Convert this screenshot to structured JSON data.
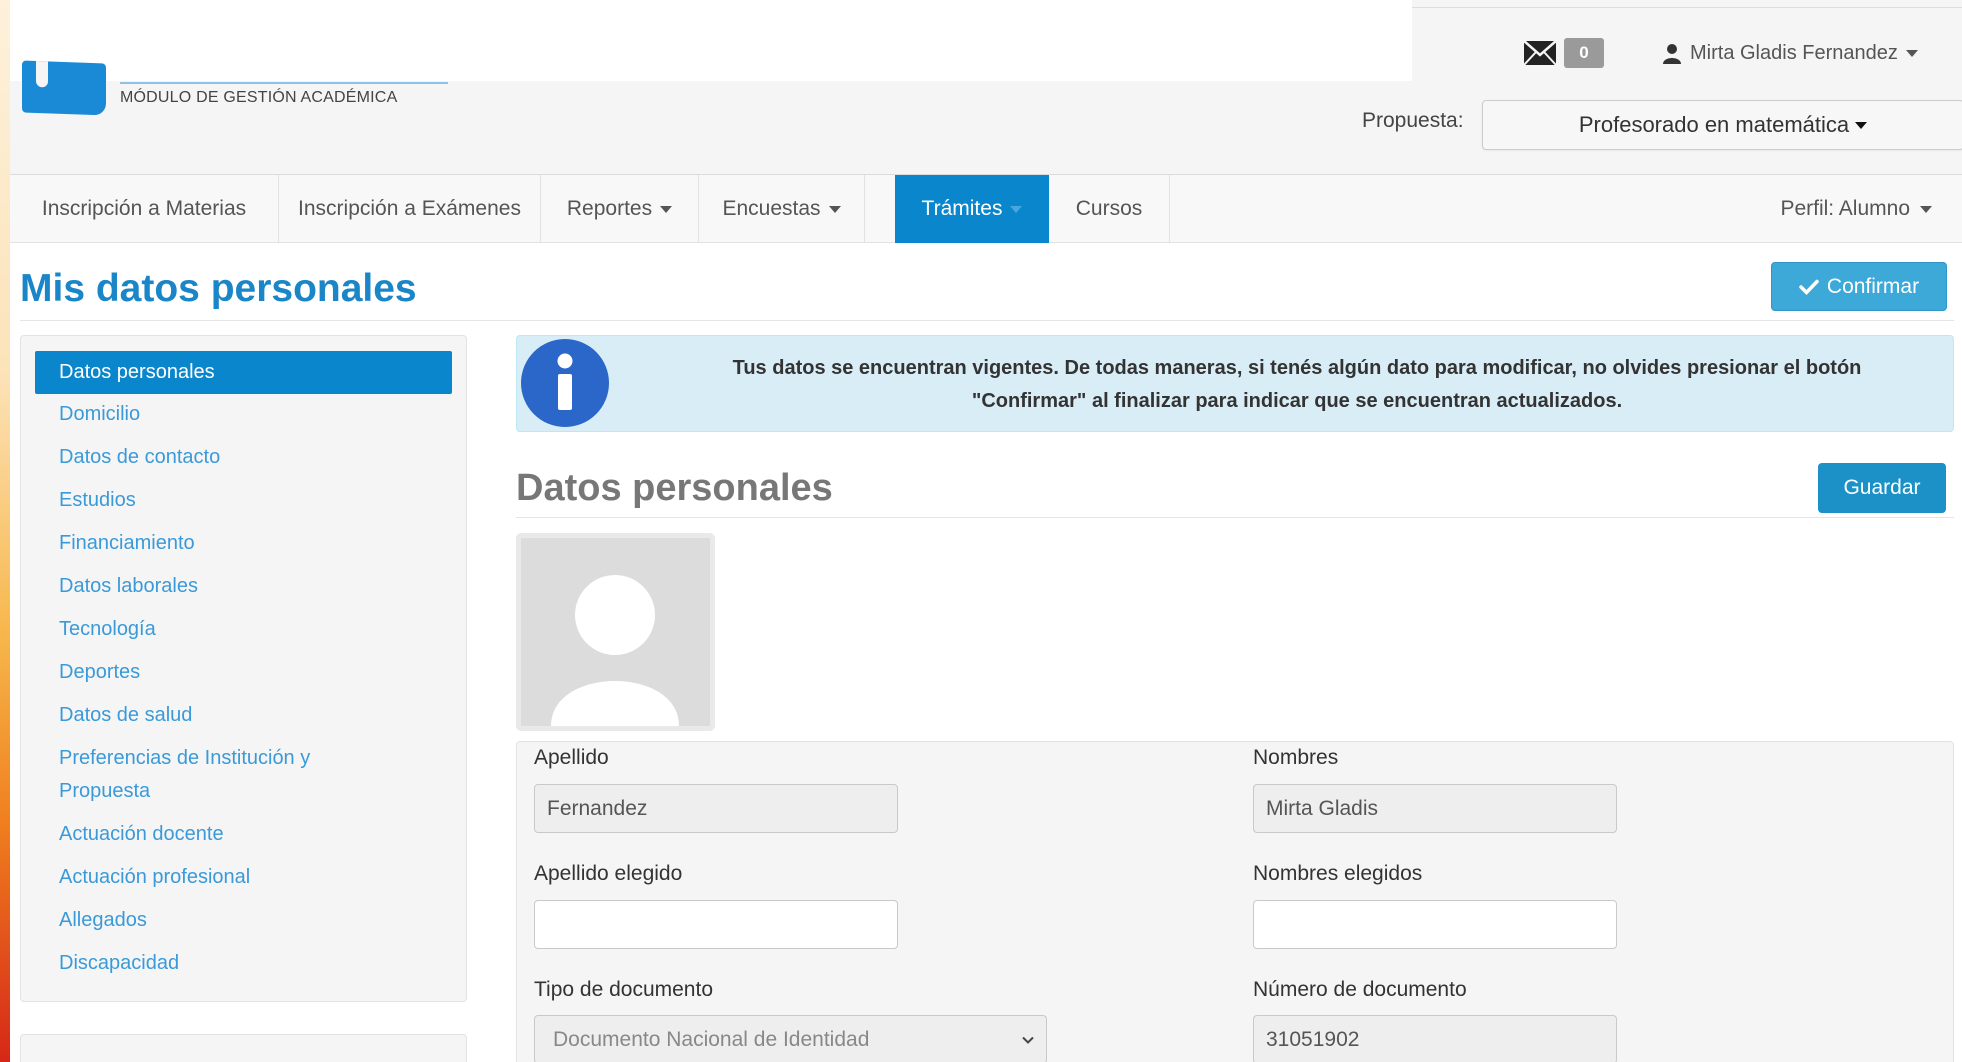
{
  "header": {
    "logo_subtitle": "MÓDULO DE GESTIÓN ACADÉMICA",
    "mail_count": "0",
    "user_name": "Mirta Gladis Fernandez",
    "propuesta_label": "Propuesta:",
    "propuesta_value": "Profesorado en matemática"
  },
  "nav": {
    "items": [
      {
        "label": "Inscripción a Materias"
      },
      {
        "label": "Inscripción a Exámenes"
      },
      {
        "label": "Reportes"
      },
      {
        "label": "Encuestas"
      },
      {
        "label": "Trámites"
      },
      {
        "label": "Cursos"
      }
    ],
    "active": "Trámites",
    "perfil": "Perfil: Alumno"
  },
  "page": {
    "title": "Mis datos personales",
    "confirm_button": "Confirmar"
  },
  "sidebar": {
    "items": [
      {
        "label": "Datos personales"
      },
      {
        "label": "Domicilio"
      },
      {
        "label": "Datos de contacto"
      },
      {
        "label": "Estudios"
      },
      {
        "label": "Financiamiento"
      },
      {
        "label": "Datos laborales"
      },
      {
        "label": "Tecnología"
      },
      {
        "label": "Deportes"
      },
      {
        "label": "Datos de salud"
      },
      {
        "label": "Preferencias de Institución y"
      },
      {
        "label": "Propuesta"
      },
      {
        "label": "Actuación docente"
      },
      {
        "label": "Actuación profesional"
      },
      {
        "label": "Allegados"
      },
      {
        "label": "Discapacidad"
      }
    ],
    "active": "Datos personales"
  },
  "alert": {
    "line1": "Tus datos se encuentran vigentes. De todas maneras, si tenés algún dato para modificar, no olvides presionar el botón",
    "line2": "\"Confirmar\" al finalizar para indicar que se encuentran actualizados."
  },
  "section": {
    "title": "Datos personales",
    "save_button": "Guardar"
  },
  "form": {
    "apellido_label": "Apellido",
    "apellido_value": "Fernandez",
    "nombres_label": "Nombres",
    "nombres_value": "Mirta Gladis",
    "apellido_elegido_label": "Apellido elegido",
    "apellido_elegido_value": "",
    "nombres_elegidos_label": "Nombres elegidos",
    "nombres_elegidos_value": "",
    "tipo_doc_label": "Tipo de documento",
    "tipo_doc_value": "Documento Nacional de Identidad",
    "numero_doc_label": "Número de documento",
    "numero_doc_value": "31051902"
  },
  "colors": {
    "primary": "#0a86cc",
    "title_blue": "#1a86c8",
    "link_blue": "#3a9ad9",
    "alert_bg": "#d9edf7",
    "info_icon": "#2a67c9"
  }
}
